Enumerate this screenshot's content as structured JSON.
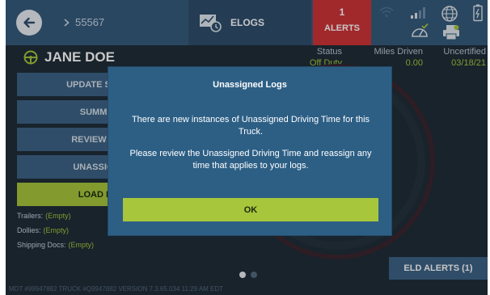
{
  "topbar": {
    "breadcrumb_id": "55567",
    "elogs_label": "ELOGS",
    "alerts_count": "1",
    "alerts_label": "ALERTS"
  },
  "driver": {
    "name": "JANE DOE",
    "status_label": "Status",
    "status_value": "Off Duty",
    "miles_label": "Miles Driven",
    "miles_value": "0.00",
    "uncertified_label": "Uncertified",
    "uncertified_value": "03/18/21"
  },
  "menu": {
    "update_status": "UPDATE STATUS",
    "summary": "SUMMARY",
    "review_logs": "REVIEW LOGS",
    "unassigned": "UNASSIGNED",
    "load_info": "LOAD INFO"
  },
  "info": {
    "trailers_label": "Trailers:",
    "trailers_value": "(Empty)",
    "dollies_label": "Dollies:",
    "dollies_value": "(Empty)",
    "shipping_label": "Shipping Docs:",
    "shipping_value": "(Empty)"
  },
  "eld_alerts_label": "ELD ALERTS (1)",
  "footer": "MDT #99947882    TRUCK #Q9947882    VERSION  7.3.65.034    11:29 AM EDT",
  "dialog": {
    "title": "Unassigned Logs",
    "line1": "There are new instances of Unassigned Driving Time for this Truck.",
    "line2": "Please review the Unassigned Driving Time and reassign any time that applies to your logs.",
    "ok_label": "OK"
  },
  "colors": {
    "accent_green": "#a7c63b",
    "alert_red": "#cf3438",
    "bar_blue": "#365b7d",
    "dialog_blue": "#2d5f85"
  },
  "icons": [
    "back-arrow-icon",
    "chevron-right-icon",
    "elogs-truck-icon",
    "wifi-icon",
    "signal-bars-icon",
    "globe-icon",
    "battery-icon",
    "speedometer-check-icon",
    "printer-icon",
    "steering-wheel-icon"
  ]
}
